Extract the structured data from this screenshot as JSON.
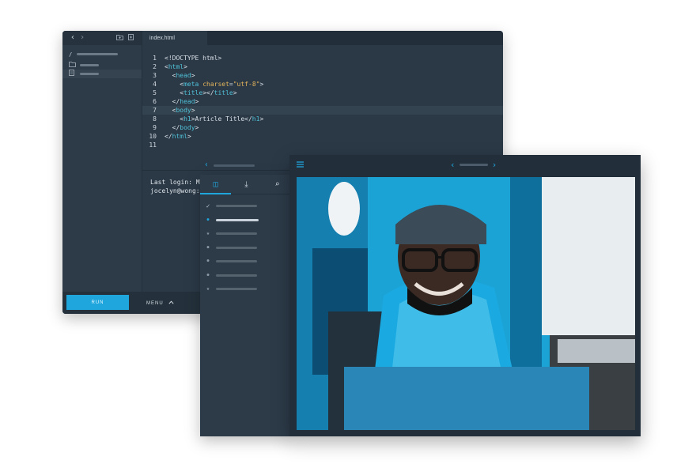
{
  "editor": {
    "tab_label": "index.html",
    "code_lines": [
      [
        {
          "t": "<!DOCTYPE html>",
          "c": "pu"
        }
      ],
      [
        {
          "t": "<",
          "c": "pu"
        },
        {
          "t": "html",
          "c": "tag"
        },
        {
          "t": ">",
          "c": "pu"
        }
      ],
      [
        {
          "t": "  <",
          "c": "pu"
        },
        {
          "t": "head",
          "c": "tag"
        },
        {
          "t": ">",
          "c": "pu"
        }
      ],
      [
        {
          "t": "    <",
          "c": "pu"
        },
        {
          "t": "meta ",
          "c": "tag"
        },
        {
          "t": "charset",
          "c": "attr"
        },
        {
          "t": "=",
          "c": "pu"
        },
        {
          "t": "\"utf-8\"",
          "c": "str"
        },
        {
          "t": ">",
          "c": "pu"
        }
      ],
      [
        {
          "t": "    <",
          "c": "pu"
        },
        {
          "t": "title",
          "c": "tag"
        },
        {
          "t": "></",
          "c": "pu"
        },
        {
          "t": "title",
          "c": "tag"
        },
        {
          "t": ">",
          "c": "pu"
        }
      ],
      [
        {
          "t": "  </",
          "c": "pu"
        },
        {
          "t": "head",
          "c": "tag"
        },
        {
          "t": ">",
          "c": "pu"
        }
      ],
      [
        {
          "t": "  <",
          "c": "pu"
        },
        {
          "t": "body",
          "c": "tag"
        },
        {
          "t": ">",
          "c": "pu"
        }
      ],
      [
        {
          "t": "    <",
          "c": "pu"
        },
        {
          "t": "h1",
          "c": "tag"
        },
        {
          "t": ">Article Title</",
          "c": "pu"
        },
        {
          "t": "h1",
          "c": "tag"
        },
        {
          "t": ">",
          "c": "pu"
        }
      ],
      [
        {
          "t": "  </",
          "c": "pu"
        },
        {
          "t": "body",
          "c": "tag"
        },
        {
          "t": ">",
          "c": "pu"
        }
      ],
      [
        {
          "t": "</",
          "c": "pu"
        },
        {
          "t": "html",
          "c": "tag"
        },
        {
          "t": ">",
          "c": "pu"
        }
      ]
    ],
    "line_numbers": [
      "1",
      "2",
      "3",
      "4",
      "5",
      "6",
      "7",
      "8",
      "9",
      "10",
      "11"
    ],
    "highlighted_line": 7
  },
  "sidebar": {
    "path_label": "/"
  },
  "terminal": {
    "line1": "Last login: Mon",
    "line2": "jocelyn@wong:~"
  },
  "bottom_bar": {
    "run_label": "RUN",
    "menu_label": "MENU"
  },
  "panel": {
    "tabs": [
      {
        "icon": "layout-icon",
        "glyph": "◫"
      },
      {
        "icon": "download-icon",
        "glyph": "⤓"
      },
      {
        "icon": "search-icon",
        "glyph": "⌕"
      }
    ],
    "items": [
      {
        "marker": "check",
        "glyph": "✓",
        "bar": 52
      },
      {
        "marker": "dot-blue",
        "glyph": "●",
        "bar": 54
      },
      {
        "marker": "star",
        "glyph": "★",
        "bar": 52
      },
      {
        "marker": "dot",
        "glyph": "●",
        "bar": 52
      },
      {
        "marker": "dot",
        "glyph": "●",
        "bar": 52
      },
      {
        "marker": "dot",
        "glyph": "●",
        "bar": 52
      },
      {
        "marker": "star",
        "glyph": "★",
        "bar": 52
      }
    ]
  },
  "colors": {
    "accent": "#1fa6dd",
    "panel_bg": "#2d3b49",
    "editor_bg": "#2b3947"
  },
  "icons": {
    "back": "‹",
    "forward": "›",
    "hamburger": "≡",
    "chevron_up": "˄",
    "pause": "❚❚"
  }
}
